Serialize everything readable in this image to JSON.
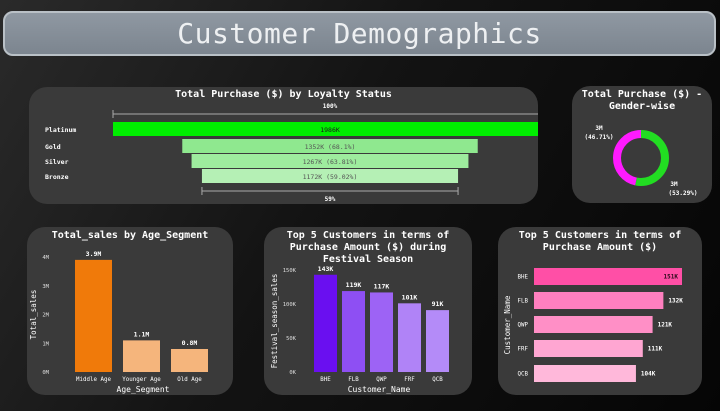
{
  "header": {
    "title": "Customer Demographics"
  },
  "chart_data": [
    {
      "type": "funnel",
      "title": "Total Purchase ($) by Loyalty Status",
      "categories": [
        "Platinum",
        "Gold",
        "Silver",
        "Bronze"
      ],
      "values": [
        1986,
        1352,
        1267,
        1172
      ],
      "labels": [
        "1986K",
        "1352K (68.1%)",
        "1267K (63.81%)",
        "1172K (59.02%)"
      ],
      "top_label": "100%",
      "bottom_label": "59%",
      "colors": [
        "#00ee00",
        "#8fe88f",
        "#9eec9e",
        "#b5f0b5"
      ]
    },
    {
      "type": "pie",
      "title": "Total Purchase ($) - Gender-wise",
      "values": [
        46.71,
        53.29
      ],
      "labels": [
        "3M\n(46.71%)",
        "3M\n(53.29%)"
      ],
      "colors": [
        "#ff1aff",
        "#22dd22"
      ]
    },
    {
      "type": "bar",
      "title": "Total_sales by Age_Segment",
      "categories": [
        "Middle Age",
        "Younger Age",
        "Old Age"
      ],
      "values": [
        3.9,
        1.1,
        0.8
      ],
      "data_labels": [
        "3.9M",
        "1.1M",
        "0.8M"
      ],
      "xlabel": "Age_Segment",
      "ylabel": "Total_sales",
      "ylim": [
        0,
        4
      ],
      "yticks": [
        "0M",
        "1M",
        "2M",
        "3M",
        "4M"
      ],
      "colors": [
        "#f07a0a",
        "#f5b57c",
        "#f5b57c"
      ]
    },
    {
      "type": "bar",
      "title": "Top 5 Customers in terms of Purchase Amount ($) during Festival Season",
      "categories": [
        "BHE",
        "FLB",
        "QWP",
        "FRF",
        "QCB"
      ],
      "values": [
        143,
        119,
        117,
        101,
        91
      ],
      "data_labels": [
        "143K",
        "119K",
        "117K",
        "101K",
        "91K"
      ],
      "xlabel": "Customer_Name",
      "ylabel": "Festival_season_sales",
      "ylim": [
        0,
        150
      ],
      "yticks": [
        "0K",
        "50K",
        "100K",
        "150K"
      ],
      "colors": [
        "#6a0ff0",
        "#8e4ff3",
        "#9d63f5",
        "#b083f7",
        "#b48bf8"
      ]
    },
    {
      "type": "bar",
      "orientation": "horizontal",
      "title": "Top 5 Customers in terms of Purchase Amount ($)",
      "categories": [
        "BHE",
        "FLB",
        "QWP",
        "FRF",
        "QCB"
      ],
      "values": [
        151,
        132,
        121,
        111,
        104
      ],
      "data_labels": [
        "151K",
        "132K",
        "121K",
        "111K",
        "104K"
      ],
      "ylabel": "Customer_Name",
      "colors": [
        "#ff4fa6",
        "#ff7fbf",
        "#ff8fc6",
        "#ffa6d2",
        "#ffb8da"
      ]
    }
  ]
}
